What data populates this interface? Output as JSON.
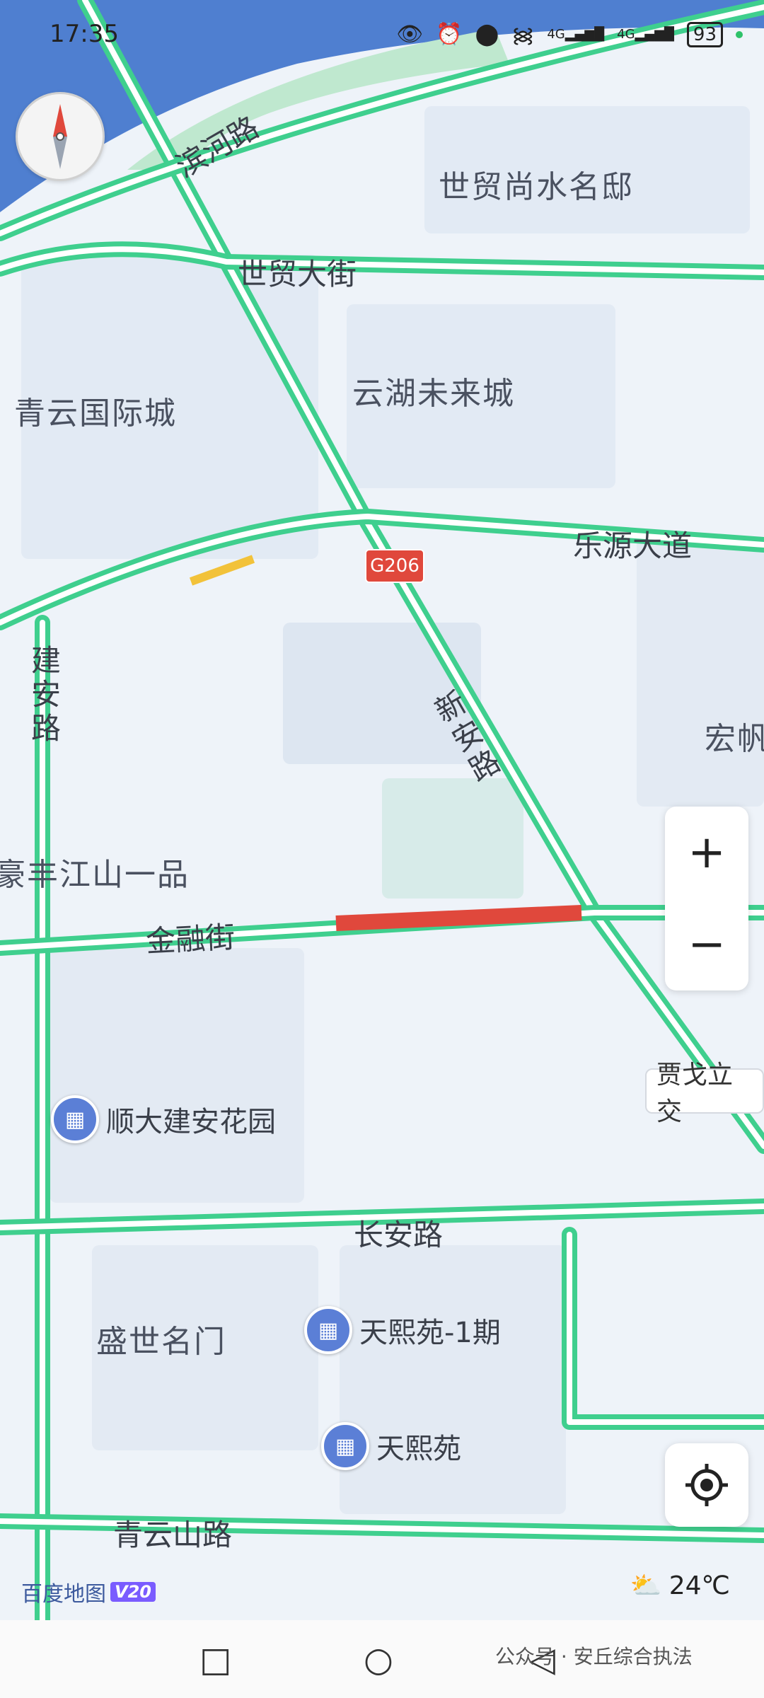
{
  "status_bar": {
    "time": "17:35",
    "icons": [
      "eye-icon",
      "alarm-icon",
      "location-icon",
      "wifi-icon",
      "signal-4g-icon",
      "signal-4g-icon"
    ],
    "net1": "4G",
    "net2": "4G",
    "battery": "93"
  },
  "map": {
    "area_labels": {
      "shimao": "世贸尚水名邸",
      "yunhu": "云湖未来城",
      "qingyun": "青云国际城",
      "hongfan": "宏帆",
      "haofeng": "豪丰江山一品",
      "shengshi": "盛世名门"
    },
    "road_labels": {
      "binhe": "滨河路",
      "shimao_st": "世贸大街",
      "leyuan": "乐源大道",
      "jianan": "建安路",
      "xinan": "新安路",
      "jinrong": "金融街",
      "changan": "长安路",
      "qingyunshan": "青云山路"
    },
    "highway_shield": "G206",
    "callout": "贾戈立交",
    "pois": [
      {
        "name": "顺大建安花园",
        "icon": "building-icon"
      },
      {
        "name": "天熙苑-1期",
        "icon": "building-icon"
      },
      {
        "name": "天熙苑",
        "icon": "building-icon"
      }
    ],
    "traffic_colors": {
      "free": "#3fcf8e",
      "slow": "#f2c23a",
      "jam": "#e0483c"
    }
  },
  "controls": {
    "zoom_in": "+",
    "zoom_out": "−",
    "compass_icon": "compass-icon",
    "locate_icon": "locate-icon"
  },
  "footer": {
    "logo": "百度地图",
    "version": "V20",
    "temperature": "24℃",
    "weather_icon": "partly-cloudy-icon"
  },
  "navbar": {
    "recent": "□",
    "home": "○",
    "back": "◁",
    "watermark": "公众号 · 安丘综合执法"
  }
}
